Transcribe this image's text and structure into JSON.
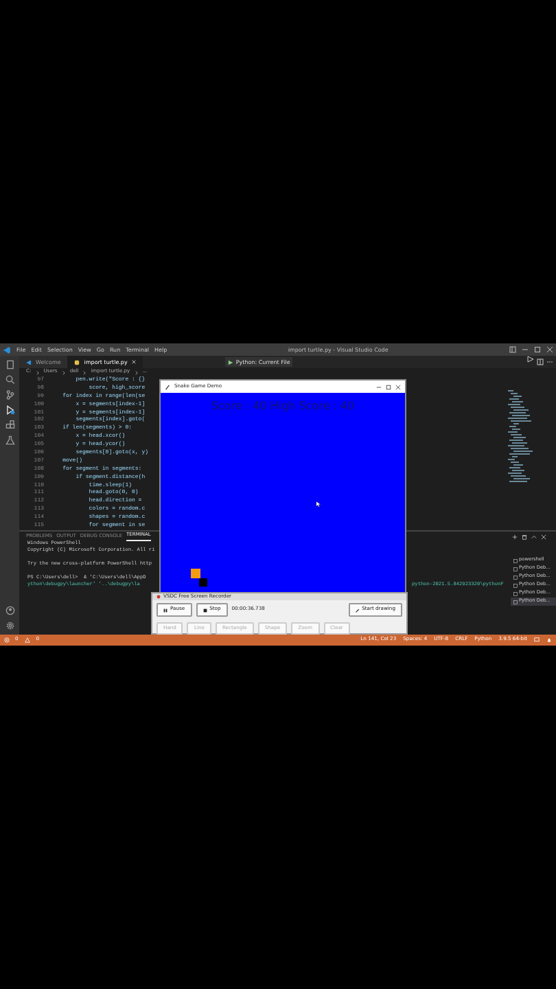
{
  "title_bar": {
    "menu": [
      "File",
      "Edit",
      "Selection",
      "View",
      "Go",
      "Run",
      "Terminal",
      "Help"
    ],
    "title": "import turtle.py - Visual Studio Code"
  },
  "editor_tabs": [
    {
      "label": "Welcome",
      "selected": false
    },
    {
      "label": "import turtle.py",
      "selected": true
    }
  ],
  "debug_toolbar": {
    "configuration": "Python: Current File"
  },
  "breadcrumb": [
    "C:",
    "Users",
    "dell",
    "import turtle.py",
    "..."
  ],
  "code_lines": [
    {
      "number": "97",
      "text": "        pen.write(\"Score : {}"
    },
    {
      "number": "98",
      "text": "            score, high_score"
    },
    {
      "number": "99",
      "text": "    for index in range(len(se"
    },
    {
      "number": "100",
      "text": "        x = segments[index-1]"
    },
    {
      "number": "101",
      "text": "        y = segments[index-1]"
    },
    {
      "number": "102",
      "text": "        segments[index].goto("
    },
    {
      "number": "103",
      "text": "    if len(segments) > 0:"
    },
    {
      "number": "104",
      "text": "        x = head.xcor()"
    },
    {
      "number": "105",
      "text": "        y = head.ycor()"
    },
    {
      "number": "106",
      "text": "        segments[0].goto(x, y)"
    },
    {
      "number": "107",
      "text": "    move()"
    },
    {
      "number": "108",
      "text": "    for segment in segments:"
    },
    {
      "number": "109",
      "text": "        if segment.distance(h"
    },
    {
      "number": "110",
      "text": "            time.sleep(1)"
    },
    {
      "number": "111",
      "text": "            head.goto(0, 0)"
    },
    {
      "number": "112",
      "text": "            head.direction ="
    },
    {
      "number": "113",
      "text": "            colors = random.c"
    },
    {
      "number": "114",
      "text": "            shapes = random.c"
    },
    {
      "number": "115",
      "text": "            for segment in se"
    }
  ],
  "panel": {
    "tabs": [
      {
        "label": "PROBLEMS",
        "selected": false
      },
      {
        "label": "OUTPUT",
        "selected": false
      },
      {
        "label": "DEBUG CONSOLE",
        "selected": false
      },
      {
        "label": "TERMINAL",
        "selected": true
      }
    ],
    "terminal_lines": [
      "Windows PowerShell",
      "Copyright (C) Microsoft Corporation. All ri",
      "Try the new cross-platform PowerShell http",
      "PS C:\\Users\\dell>  & 'C:\\Users\\dell\\AppD"
    ],
    "terminal_wrap": {
      "left": "ython\\debugpy\\launcher' '..\\debugpy\\la",
      "right": "python-2021.5.842923320\\pythonF"
    },
    "terminals": [
      {
        "label": "powershell",
        "selected": false
      },
      {
        "label": "Python Deb...",
        "selected": false
      },
      {
        "label": "Python Deb...",
        "selected": false
      },
      {
        "label": "Python Deb...",
        "selected": false
      },
      {
        "label": "Python Deb...",
        "selected": false
      },
      {
        "label": "Python Deb...",
        "selected": true
      }
    ]
  },
  "status_bar": {
    "problems": [
      {
        "kind": "error",
        "count": "0"
      },
      {
        "kind": "warning",
        "count": "0"
      }
    ],
    "items": [
      "Ln 141, Col 23",
      "Spaces: 4",
      "UTF-8",
      "CRLF",
      "Python",
      "3.9.5 64-bit"
    ]
  },
  "game_window": {
    "title": "Snake Game Demo",
    "score": "Score : 40  High Score : 40"
  },
  "recorder": {
    "title": "VSDC Free Screen Recorder",
    "controls": [
      {
        "label": "Pause",
        "kind": "pause",
        "disabled": false
      },
      {
        "label": "Stop",
        "kind": "stop",
        "disabled": false
      }
    ],
    "time": "00:00:36.738",
    "start": "Start drawing",
    "tools": [
      {
        "label": "Hand",
        "disabled": true
      },
      {
        "label": "Line",
        "disabled": true
      },
      {
        "label": "Rectangle",
        "disabled": true
      },
      {
        "label": "Shape",
        "disabled": true
      },
      {
        "label": "Zoom",
        "disabled": true
      },
      {
        "label": "Clear",
        "disabled": true
      }
    ]
  }
}
